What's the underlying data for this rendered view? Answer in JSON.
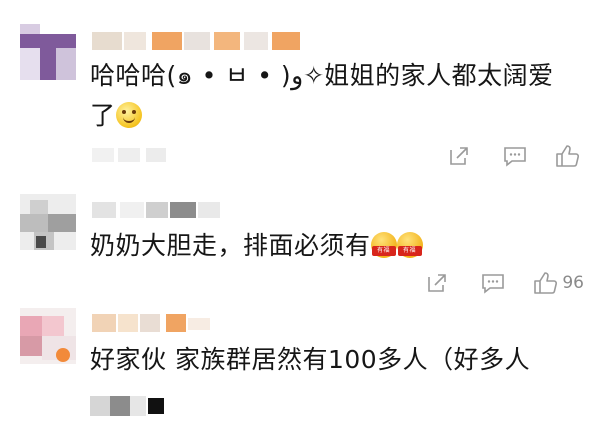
{
  "comments": [
    {
      "text_main": "哈哈哈(๑•̀ㅂ•́)و✧姐姐的家人都太阔爱了",
      "text_line1": "哈哈哈(๑ • ㅂ • )و✧姐姐的家人都太阔爱",
      "text_line2": "了",
      "emoji": "smile-emoji",
      "like_count": ""
    },
    {
      "text": "奶奶大胆走，排面必须有",
      "emoji_tag": "有福",
      "like_count": "96"
    },
    {
      "text": "好家伙 家族群居然有100多人（好多人"
    }
  ],
  "colors": {
    "text": "#161616",
    "icon": "#9a9a9a",
    "purple_avatar": "#7f5a9b",
    "meta_orange": "#f09a52",
    "emoji_red": "#d8261c"
  },
  "icons": [
    "share-icon",
    "comment-icon",
    "like-icon"
  ]
}
